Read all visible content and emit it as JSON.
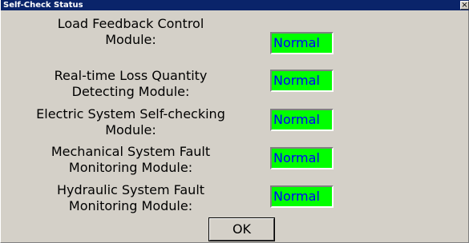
{
  "window": {
    "title": "Self-Check Status",
    "close_glyph": "×"
  },
  "modules": [
    {
      "label_line1": "Load Feedback Control",
      "label_line2": "Module:",
      "status": "Normal"
    },
    {
      "label_line1": "Real-time Loss Quantity",
      "label_line2": "Detecting Module:",
      "status": "Normal"
    },
    {
      "label_line1": "Electric System Self-checking",
      "label_line2": "Module:",
      "status": "Normal"
    },
    {
      "label_line1": "Mechanical System Fault",
      "label_line2": "Monitoring Module:",
      "status": "Normal"
    },
    {
      "label_line1": "Hydraulic System Fault",
      "label_line2": "Monitoring Module:",
      "status": "Normal"
    }
  ],
  "buttons": {
    "ok_label": "OK"
  },
  "colors": {
    "titlebar": "#0a246a",
    "status_background": "#00ff00",
    "status_text": "#0000ff",
    "dialog_background": "#d4d0c8"
  }
}
